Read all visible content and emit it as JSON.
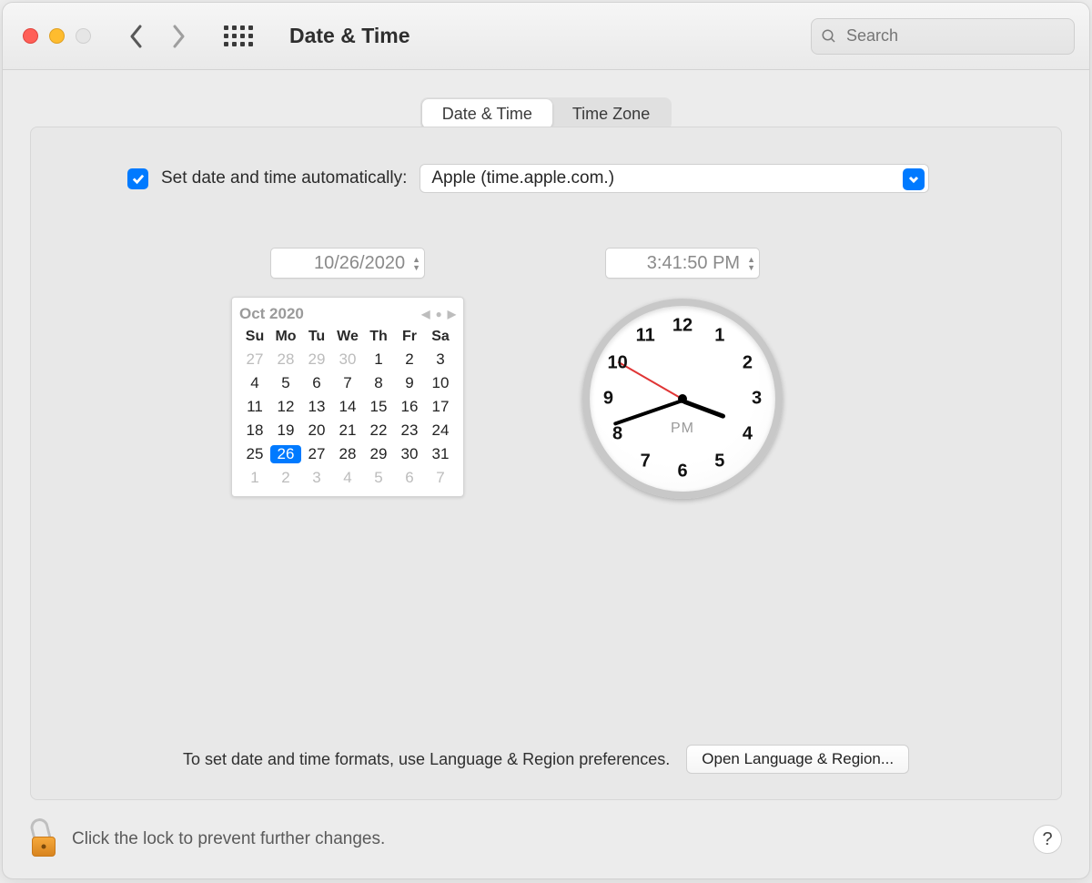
{
  "header": {
    "title": "Date & Time",
    "search_placeholder": "Search"
  },
  "tabs": [
    {
      "label": "Date & Time",
      "active": true
    },
    {
      "label": "Time Zone",
      "active": false
    }
  ],
  "auto": {
    "checked": true,
    "label": "Set date and time automatically:",
    "server": "Apple (time.apple.com.)"
  },
  "date": {
    "value": "10/26/2020"
  },
  "time": {
    "value": "3:41:50 PM",
    "hour": 3,
    "minute": 41,
    "second": 50,
    "ampm": "PM"
  },
  "calendar": {
    "month_label": "Oct 2020",
    "dow": [
      "Su",
      "Mo",
      "Tu",
      "We",
      "Th",
      "Fr",
      "Sa"
    ],
    "cells": [
      {
        "n": 27,
        "out": true
      },
      {
        "n": 28,
        "out": true
      },
      {
        "n": 29,
        "out": true
      },
      {
        "n": 30,
        "out": true
      },
      {
        "n": 1
      },
      {
        "n": 2
      },
      {
        "n": 3
      },
      {
        "n": 4
      },
      {
        "n": 5
      },
      {
        "n": 6
      },
      {
        "n": 7
      },
      {
        "n": 8
      },
      {
        "n": 9
      },
      {
        "n": 10
      },
      {
        "n": 11
      },
      {
        "n": 12
      },
      {
        "n": 13
      },
      {
        "n": 14
      },
      {
        "n": 15
      },
      {
        "n": 16
      },
      {
        "n": 17
      },
      {
        "n": 18
      },
      {
        "n": 19
      },
      {
        "n": 20
      },
      {
        "n": 21
      },
      {
        "n": 22
      },
      {
        "n": 23
      },
      {
        "n": 24
      },
      {
        "n": 25
      },
      {
        "n": 26,
        "sel": true
      },
      {
        "n": 27
      },
      {
        "n": 28
      },
      {
        "n": 29
      },
      {
        "n": 30
      },
      {
        "n": 31
      },
      {
        "n": 1,
        "out": true
      },
      {
        "n": 2,
        "out": true
      },
      {
        "n": 3,
        "out": true
      },
      {
        "n": 4,
        "out": true
      },
      {
        "n": 5,
        "out": true
      },
      {
        "n": 6,
        "out": true
      },
      {
        "n": 7,
        "out": true
      }
    ]
  },
  "clock_numbers": [
    "12",
    "1",
    "2",
    "3",
    "4",
    "5",
    "6",
    "7",
    "8",
    "9",
    "10",
    "11"
  ],
  "panel_footer": {
    "hint": "To set date and time formats, use Language & Region preferences.",
    "button": "Open Language & Region..."
  },
  "lock_text": "Click the lock to prevent further changes.",
  "help": "?"
}
